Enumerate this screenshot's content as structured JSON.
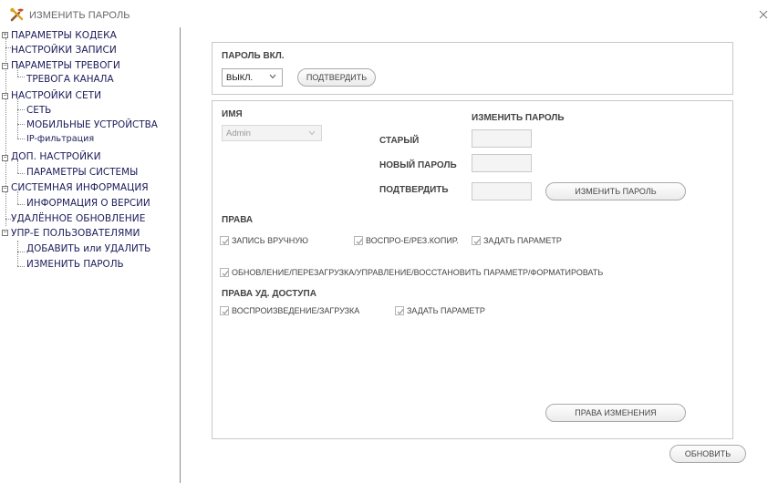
{
  "window": {
    "title": "ИЗМЕНИТЬ ПАРОЛЬ",
    "app_icon": "tools-icon",
    "close_icon": "close-icon"
  },
  "sidebar": {
    "items": [
      {
        "label": "ПАРАМЕТРЫ КОДЕКА",
        "expander": "+"
      },
      {
        "label": "НАСТРОЙКИ ЗАПИСИ"
      },
      {
        "label": "ПАРАМЕТРЫ ТРЕВОГИ",
        "expander": "−"
      },
      {
        "label": "ТРЕВОГА КАНАЛА"
      },
      {
        "label": "НАСТРОЙКИ СЕТИ",
        "expander": "−"
      },
      {
        "label": "СЕТЬ"
      },
      {
        "label": "МОБИЛЬНЫЕ УСТРОЙСТВА"
      },
      {
        "label": "IP-фильтрация"
      },
      {
        "label": "ДОП. НАСТРОЙКИ",
        "expander": "−"
      },
      {
        "label": "ПАРАМЕТРЫ СИСТЕМЫ"
      },
      {
        "label": "СИСТЕМНАЯ ИНФОРМАЦИЯ",
        "expander": "−"
      },
      {
        "label": "ИНФОРМАЦИЯ О ВЕРСИИ"
      },
      {
        "label": "УДАЛЁННОЕ ОБНОВЛЕНИЕ"
      },
      {
        "label": "УПР-Е ПОЛЬЗОВАТЕЛЯМИ",
        "expander": "−"
      },
      {
        "label": "ДОБАВИТЬ или УДАЛИТЬ"
      },
      {
        "label": "ИЗМЕНИТЬ ПАРОЛЬ"
      }
    ]
  },
  "password_on": {
    "heading": "ПАРОЛЬ ВКЛ.",
    "select_value": "ВЫКЛ.",
    "confirm_label": "ПОДТВЕРДИТЬ"
  },
  "user": {
    "name_heading": "ИМЯ",
    "name_value": "Admin",
    "change_heading": "ИЗМЕНИТЬ ПАРОЛЬ",
    "old_label": "СТАРЫЙ",
    "new_label": "НОВЫЙ ПАРОЛЬ",
    "confirm_label": "ПОДТВЕРДИТЬ",
    "change_button": "ИЗМЕНИТЬ ПАРОЛЬ"
  },
  "rights": {
    "heading": "ПРАВА",
    "manual_record": "ЗАПИСЬ ВРУЧНУЮ",
    "playback_backup": "ВОСПРО-Е/РЕЗ.КОПИР.",
    "set_param": "ЗАДАТЬ ПАРАМЕТР",
    "update_line": "ОБНОВЛЕНИЕ/ПЕРЕЗАГРУЗКА/УПРАВЛЕНИЕ/ВОССТАНОВИТЬ ПАРАМЕТР/ФОРМАТИРОВАТЬ"
  },
  "remote_rights": {
    "heading": "ПРАВА УД. ДОСТУПА",
    "playback_download": "ВОСПРОИЗВЕДЕНИЕ/ЗАГРУЗКА",
    "set_param": "ЗАДАТЬ ПАРАМЕТР"
  },
  "change_rights_button": "ПРАВА ИЗМЕНЕНИЯ",
  "refresh_button": "ОБНОВИТЬ"
}
